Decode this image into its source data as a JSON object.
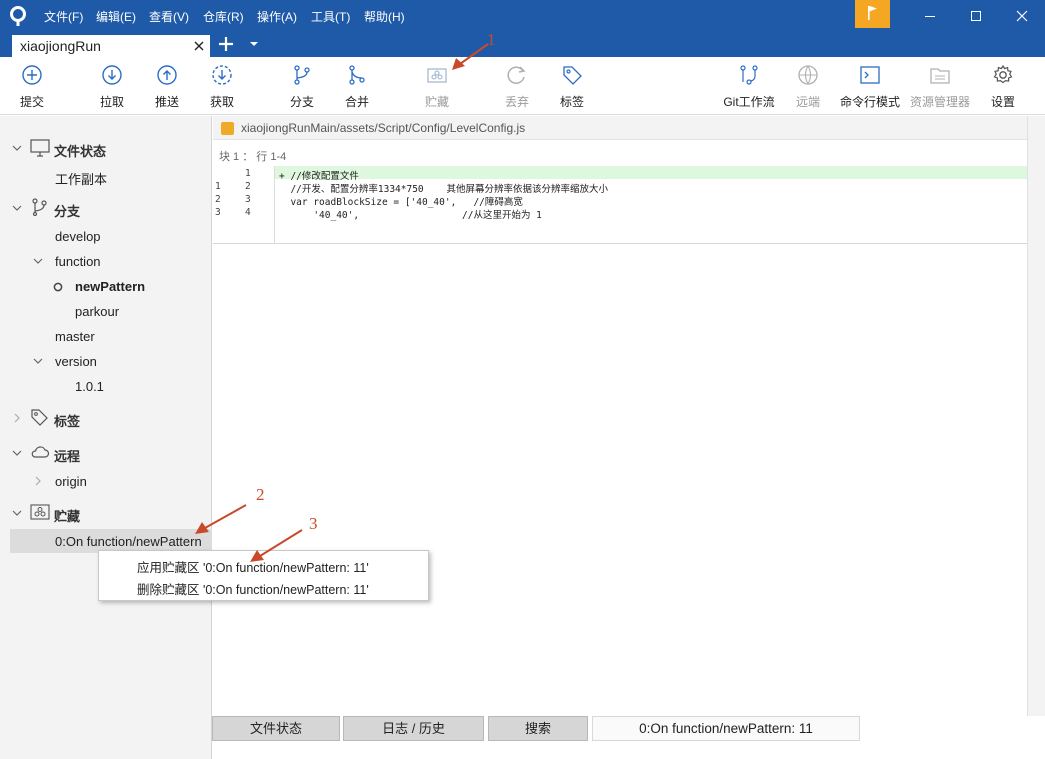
{
  "colors": {
    "titlebar": "#1f5aa8",
    "flag": "#f5a623",
    "annotation": "#c94a2a",
    "added_line": "#ddf8dd"
  },
  "menu": [
    "文件(F)",
    "编辑(E)",
    "查看(V)",
    "仓库(R)",
    "操作(A)",
    "工具(T)",
    "帮助(H)"
  ],
  "tab": {
    "repo": "xiaojiongRun"
  },
  "toolbar": {
    "commit": "提交",
    "pull": "拉取",
    "push": "推送",
    "fetch": "获取",
    "branch": "分支",
    "merge": "合并",
    "stash": "贮藏",
    "discard": "丢弃",
    "tag": "标签",
    "gitflow": "Git工作流",
    "remote": "远端",
    "terminal": "命令行模式",
    "explorer": "资源管理器",
    "settings": "设置"
  },
  "sidebar": {
    "file_status": "文件状态",
    "working_copy": "工作副本",
    "branches": "分支",
    "develop": "develop",
    "function": "function",
    "newPattern": "newPattern",
    "parkour": "parkour",
    "master": "master",
    "version": "version",
    "v101": "1.0.1",
    "tags": "标签",
    "remotes": "远程",
    "origin": "origin",
    "stashes": "贮藏",
    "stash_item": "0:On function/newPattern"
  },
  "context_menu": {
    "apply": "应用贮藏区 '0:On function/newPattern: 11'",
    "delete": "删除贮藏区 '0:On function/newPattern: 11'"
  },
  "diff": {
    "file_path": "xiaojiongRunMain/assets/Script/Config/LevelConfig.js",
    "hunk": "块 1 ： 行 1-4",
    "lines": [
      {
        "old": "",
        "new": "1",
        "text": "+ //修改配置文件"
      },
      {
        "old": "1",
        "new": "2",
        "text": "  //开发、配置分辨率1334*750    其他屏幕分辨率依据该分辨率缩放大小"
      },
      {
        "old": "2",
        "new": "3",
        "text": "  var roadBlockSize = ['40_40',   //障碍高宽"
      },
      {
        "old": "3",
        "new": "4",
        "text": "      '40_40',                  //从这里开始为 1"
      }
    ]
  },
  "bottom_tabs": {
    "file_status": "文件状态",
    "log": "日志 / 历史",
    "search": "搜索",
    "stash": "0:On function/newPattern: 11"
  },
  "annotations": {
    "a1": "1",
    "a2": "2",
    "a3": "3"
  }
}
